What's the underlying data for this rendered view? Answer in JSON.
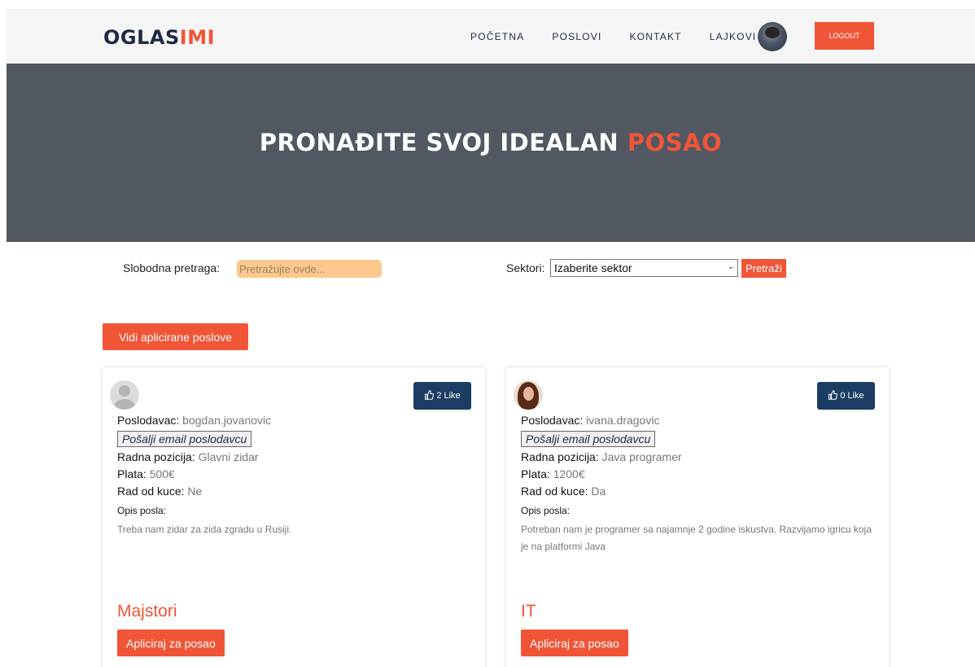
{
  "header": {
    "logo_main": "OGLAS",
    "logo_accent": "IMI",
    "nav": [
      "POČETNA",
      "POSLOVI",
      "KONTAKT",
      "LAJKOVI"
    ],
    "logout_label": "LOGOUT"
  },
  "hero": {
    "title_main": "PRONAĐITE SVOJ IDEALAN",
    "title_accent": "POSAO"
  },
  "search": {
    "label": "Slobodna pretraga:",
    "placeholder": "Pretražujte ovde...",
    "sector_label": "Sektori:",
    "sector_selected": "Izaberite sektor",
    "button_label": "Pretraži"
  },
  "applied_button": "Vidi aplicirane poslove",
  "labels": {
    "employer": "Poslodavac:",
    "email_button": "Pošalji email poslodavcu",
    "position": "Radna pozicija:",
    "salary": "Plata:",
    "remote": "Rad od kuce:",
    "description": "Opis posla:",
    "apply": "Apliciraj za posao"
  },
  "jobs": [
    {
      "employer": "bogdan.jovanovic",
      "position": "Glavni zidar",
      "salary": "500€",
      "remote": "Ne",
      "description": "Treba nam zidar za zida zgradu u Rusiji.",
      "sector": "Majstori",
      "likes": "2 Like"
    },
    {
      "employer": "ivana.dragovic",
      "position": "Java programer",
      "salary": "1200€",
      "remote": "Da",
      "description": "Potreban nam je programer sa najamnje 2 godine iskustva. Razvijamo igricu koja je na platformi Java",
      "sector": "IT",
      "likes": "0 Like"
    }
  ],
  "colors": {
    "accent": "#f05537",
    "navy": "#1c3d63",
    "hero_bg": "#515862",
    "search_bg": "#fcc88d"
  }
}
